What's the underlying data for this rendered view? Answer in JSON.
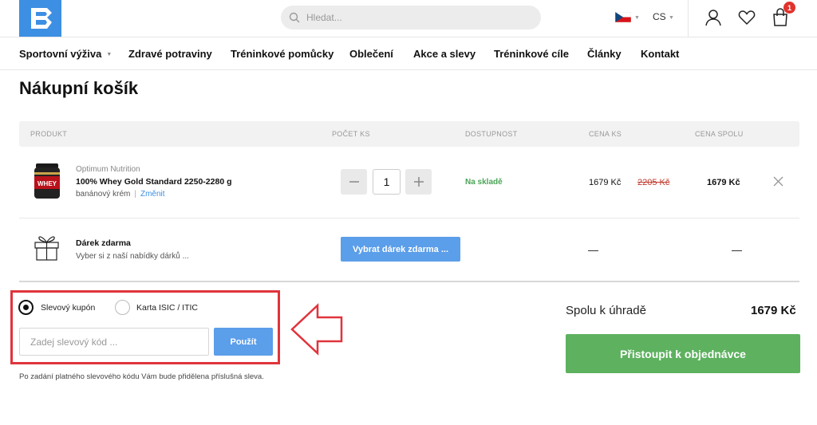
{
  "header": {
    "search_placeholder": "Hledat...",
    "language": "CS",
    "cart_count": "1"
  },
  "nav": {
    "items": [
      {
        "label": "Sportovní výživa",
        "has_dropdown": true
      },
      {
        "label": "Zdravé potraviny"
      },
      {
        "label": "Tréninkové pomůcky"
      },
      {
        "label": "Oblečení"
      },
      {
        "label": "Akce a slevy"
      },
      {
        "label": "Tréninkové cíle"
      },
      {
        "label": "Články"
      },
      {
        "label": "Kontakt"
      }
    ]
  },
  "page": {
    "title": "Nákupní košík"
  },
  "table": {
    "headers": [
      "PRODUKT",
      "POČET KS",
      "DOSTUPNOST",
      "CENA KS",
      "CENA SPOLU"
    ]
  },
  "product": {
    "brand": "Optimum Nutrition",
    "name": "100% Whey Gold Standard 2250-2280 g",
    "variant": "banánový krém",
    "change_link": "Změnit",
    "quantity": "1",
    "availability": "Na skladě",
    "price": "1679 Kč",
    "old_price": "2205 Kč",
    "total": "1679 Kč"
  },
  "gift": {
    "title": "Dárek zdarma",
    "subtitle": "Vyber si z naší nabídky dárků ...",
    "button": "Vybrat dárek zdarma ...",
    "price_dash": "—",
    "total_dash": "—"
  },
  "coupon": {
    "option_coupon": "Slevový kupón",
    "option_isic": "Karta ISIC / ITIC",
    "selected": "coupon",
    "input_placeholder": "Zadej slevový kód ...",
    "apply_button": "Použít",
    "note": "Po zadání platného slevového kódu Vám bude přidělena příslušná sleva."
  },
  "summary": {
    "label": "Spolu k úhradě",
    "value": "1679 Kč",
    "checkout_button": "Přistoupit k objednávce"
  },
  "colors": {
    "brand": "#3d8fe3",
    "accent_button": "#5b9ee9",
    "checkout_green": "#5db15f",
    "stock_green": "#4aa557",
    "highlight_red": "#e0343c"
  }
}
